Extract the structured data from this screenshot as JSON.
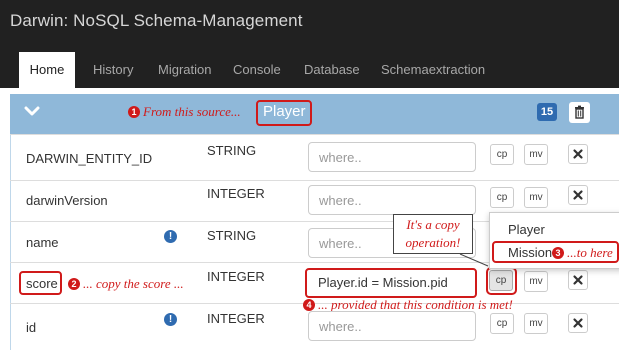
{
  "app": {
    "title": "Darwin: NoSQL Schema-Management"
  },
  "nav": {
    "tabs": [
      {
        "label": "Home",
        "active": true
      },
      {
        "label": "History",
        "active": false
      },
      {
        "label": "Migration",
        "active": false
      },
      {
        "label": "Console",
        "active": false
      },
      {
        "label": "Database",
        "active": false
      },
      {
        "label": "Schemaextraction",
        "active": false
      }
    ]
  },
  "entity": {
    "name": "Player",
    "count": "15"
  },
  "where_placeholder": "where..",
  "buttons": {
    "cp": "cp",
    "mv": "mv"
  },
  "rows": [
    {
      "name": "DARWIN_ENTITY_ID",
      "type": "STRING",
      "where": ""
    },
    {
      "name": "darwinVersion",
      "type": "INTEGER",
      "where": ""
    },
    {
      "name": "name",
      "type": "STRING",
      "where": "",
      "info": true
    },
    {
      "name": "score",
      "type": "INTEGER",
      "where": "Player.id = Mission.pid"
    },
    {
      "name": "id",
      "type": "INTEGER",
      "where": "",
      "info": true
    }
  ],
  "dropdown": {
    "items": [
      "Player",
      "Mission"
    ]
  },
  "annotations": {
    "source": {
      "num": "1",
      "text": "From this source..."
    },
    "copy": {
      "num": "2",
      "text": "... copy the score ..."
    },
    "target": {
      "num": "3",
      "text": "...to here"
    },
    "condition": {
      "num": "4",
      "text": "... provided that this condition is met!"
    },
    "callout": [
      "It's a copy",
      "operation!"
    ]
  },
  "colors": {
    "accent": "#d01a1a",
    "header": "#8fb8d9",
    "navbar": "#212121",
    "badge": "#2f6bb0"
  }
}
